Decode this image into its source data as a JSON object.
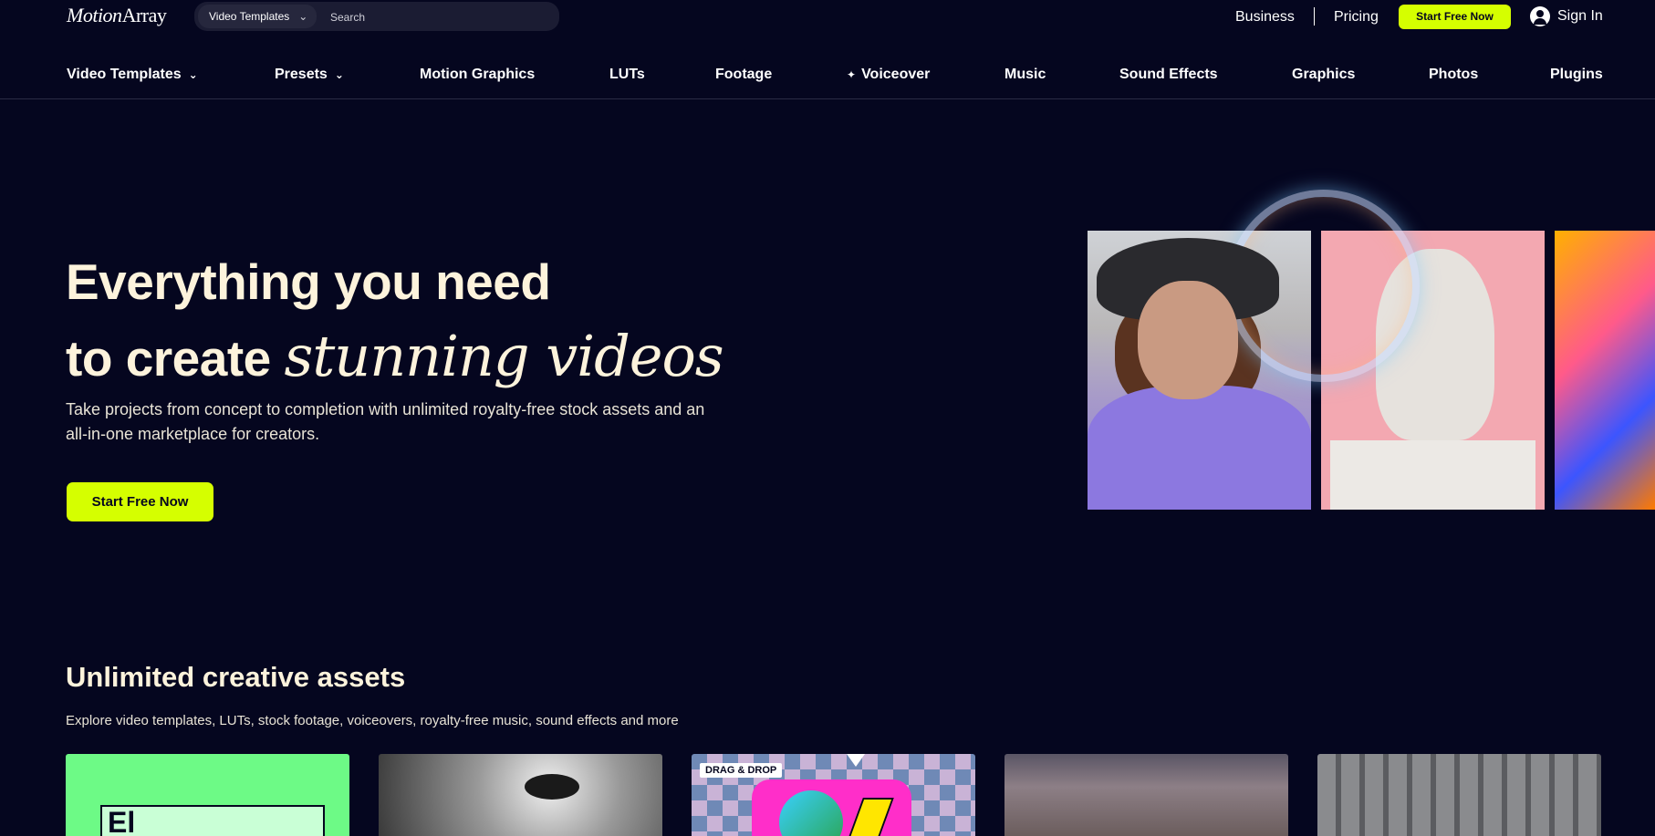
{
  "header": {
    "logo": {
      "part1": "Motion",
      "part2": "Array"
    },
    "search": {
      "category": "Video Templates",
      "placeholder": "Search"
    },
    "links": {
      "business": "Business",
      "pricing": "Pricing"
    },
    "cta": "Start Free Now",
    "signin": "Sign In"
  },
  "nav": {
    "items": [
      {
        "label": "Video Templates",
        "dropdown": true
      },
      {
        "label": "Presets",
        "dropdown": true
      },
      {
        "label": "Motion Graphics"
      },
      {
        "label": "LUTs"
      },
      {
        "label": "Footage"
      },
      {
        "label": "Voiceover",
        "icon": "sparkle-icon"
      },
      {
        "label": "Music"
      },
      {
        "label": "Sound Effects"
      },
      {
        "label": "Graphics"
      },
      {
        "label": "Photos"
      },
      {
        "label": "Plugins"
      }
    ]
  },
  "hero": {
    "line1": "Everything you need",
    "line2_prefix": "to create ",
    "line2_script": "stunning videos",
    "description": "Take projects from concept to completion with unlimited royalty-free stock assets and an all-in-one marketplace for creators.",
    "cta": "Start Free Now"
  },
  "assets": {
    "title": "Unlimited creative assets",
    "subtitle": "Explore video templates, LUTs, stock footage, voiceovers, royalty-free music, sound effects and more",
    "cards": [
      {
        "label": ""
      },
      {
        "label": ""
      },
      {
        "tag": "DRAG & DROP"
      },
      {
        "label": ""
      },
      {
        "label": ""
      }
    ]
  },
  "colors": {
    "background": "#05061f",
    "accent": "#d5ff00",
    "text": "#fdf3dc"
  }
}
